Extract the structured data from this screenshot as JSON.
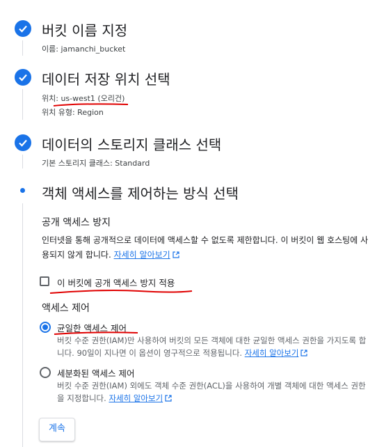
{
  "steps": [
    {
      "title": "버킷 이름 지정",
      "meta": [
        "이름: jamanchi_bucket"
      ]
    },
    {
      "title": "데이터 저장 위치 선택",
      "meta": [
        "위치: us-west1 (오리건)",
        "위치 유형: Region"
      ]
    },
    {
      "title": "데이터의 스토리지 클래스 선택",
      "meta": [
        "기본 스토리지 클래스: Standard"
      ]
    },
    {
      "title": "객체 액세스를 제어하는 방식 선택"
    }
  ],
  "public_access": {
    "heading": "공개 액세스 방지",
    "description": "인터넷을 통해 공개적으로 데이터에 액세스할 수 없도록 제한합니다. 이 버킷이 웹 호스팅에 사용되지 않게 합니다.",
    "learn_more": "자세히 알아보기",
    "checkbox_label": "이 버킷에 공개 액세스 방지 적용",
    "checkbox_checked": false
  },
  "access_control": {
    "heading": "액세스 제어",
    "options": [
      {
        "label": "균일한 액세스 제어",
        "description": "버킷 수준 권한(IAM)만 사용하여 버킷의 모든 객체에 대한 균일한 액세스 권한을 가지도록 합니다. 90일이 지나면 이 옵션이 영구적으로 적용됩니다.",
        "learn_more": "자세히 알아보기",
        "selected": true
      },
      {
        "label": "세분화된 액세스 제어",
        "description": "버킷 수준 권한(IAM) 외에도 객체 수준 권한(ACL)을 사용하여 개별 객체에 대한 액세스 권한을 지정합니다.",
        "learn_more": "자세히 알아보기",
        "selected": false
      }
    ]
  },
  "continue_label": "계속",
  "colors": {
    "accent": "#1a73e8",
    "annotation": "#e00000"
  }
}
